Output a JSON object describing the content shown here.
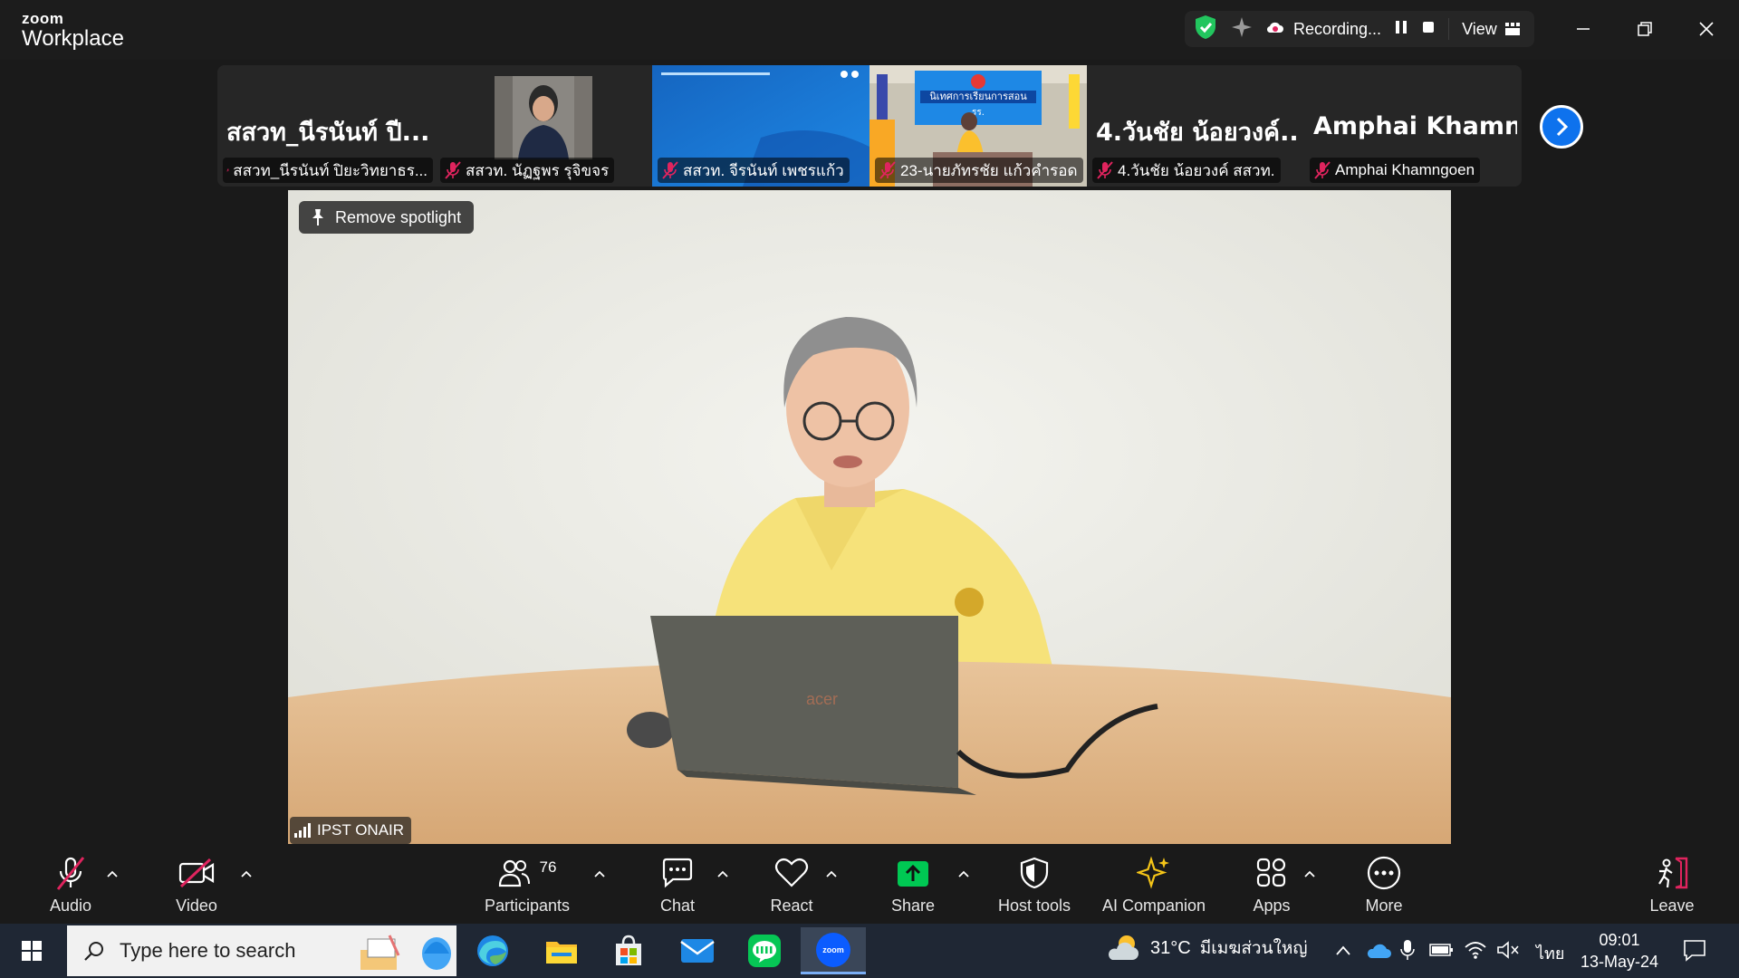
{
  "app": {
    "brand_small": "zoom",
    "brand_big": "Workplace"
  },
  "status": {
    "recording_label": "Recording...",
    "view_label": "View"
  },
  "thumbnails": [
    {
      "big": "สสวท_นีรนันท์ ปี...",
      "name": "สสวท_นีรนันท์ ปิยะวิทยาธร...",
      "kind": "name"
    },
    {
      "big": "",
      "name": "สสวท. นัฏฐพร รุจิขจร",
      "kind": "person"
    },
    {
      "big": "",
      "name": "สสวท. จีรนันท์ เพชรแก้ว",
      "kind": "slide"
    },
    {
      "big": "",
      "name": "23-นายภัทรชัย แก้วคำรอด",
      "kind": "classroom"
    },
    {
      "big": "4.วันชัย น้อยวงค์...",
      "name": "4.วันชัย น้อยวงค์ สสวท.",
      "kind": "name"
    },
    {
      "big": "Amphai  Khamn...",
      "name": "Amphai Khamngoen",
      "kind": "name"
    }
  ],
  "slide_banner": "นิเทศการเรียนการสอน",
  "slide_sub": "รร.",
  "laptop_brand": "acer",
  "stage": {
    "spotlight_label": "Remove spotlight",
    "participant_name": "IPST ONAIR"
  },
  "toolbar": {
    "audio": "Audio",
    "video": "Video",
    "participants": "Participants",
    "participants_count": "76",
    "chat": "Chat",
    "react": "React",
    "share": "Share",
    "host_tools": "Host tools",
    "ai_companion": "AI Companion",
    "apps": "Apps",
    "more": "More",
    "leave": "Leave"
  },
  "taskbar": {
    "search_placeholder": "Type here to search",
    "weather": "31°C",
    "weather_desc": "มีเมฆส่วนใหญ่",
    "language": "ไทย",
    "time": "09:01",
    "date": "13-May-24",
    "zoom_app_label": "zoom"
  },
  "colors": {
    "accent_blue": "#0e72ed",
    "share_green": "#00c853",
    "muted_red": "#e0245e",
    "ai_yellow": "#f5c518"
  }
}
